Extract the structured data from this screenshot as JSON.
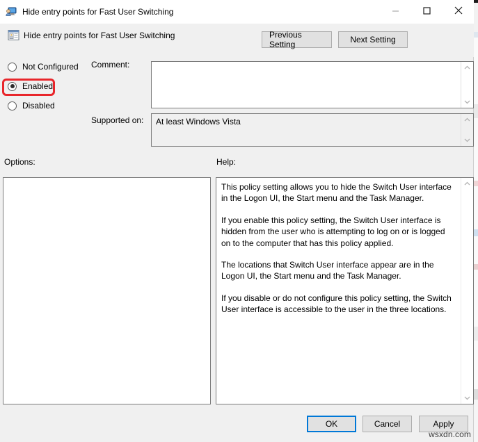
{
  "window": {
    "title": "Hide entry points for Fast User Switching",
    "title_icon": "user-switch-monitor-icon",
    "controls": {
      "minimize": "minimize-icon",
      "maximize": "maximize-icon",
      "close": "close-icon"
    }
  },
  "header": {
    "policy_icon": "policy-setting-icon",
    "policy_name": "Hide entry points for Fast User Switching",
    "previous_setting_label": "Previous Setting",
    "next_setting_label": "Next Setting"
  },
  "state": {
    "options": [
      {
        "label": "Not Configured",
        "checked": false
      },
      {
        "label": "Enabled",
        "checked": true
      },
      {
        "label": "Disabled",
        "checked": false
      }
    ],
    "selected": "Enabled",
    "highlight_color": "#e8262b"
  },
  "fields": {
    "comment_label": "Comment:",
    "comment_value": "",
    "supported_label": "Supported on:",
    "supported_value": "At least Windows Vista"
  },
  "sections": {
    "options_label": "Options:",
    "help_label": "Help:",
    "options_content": "",
    "help_paragraphs": [
      "This policy setting allows you to hide the Switch User interface in the Logon UI, the Start menu and the Task Manager.",
      "If you enable this policy setting, the Switch User interface is hidden from the user who is attempting to log on or is logged on to the computer that has this policy applied.",
      "The locations that Switch User interface appear are in the Logon UI, the Start menu and the Task Manager.",
      "If you disable or do not configure this policy setting, the Switch User interface is accessible to the user in the three locations."
    ]
  },
  "footer": {
    "ok_label": "OK",
    "cancel_label": "Cancel",
    "apply_label": "Apply",
    "focused_button": "OK"
  },
  "watermark": "wsxdn.com"
}
